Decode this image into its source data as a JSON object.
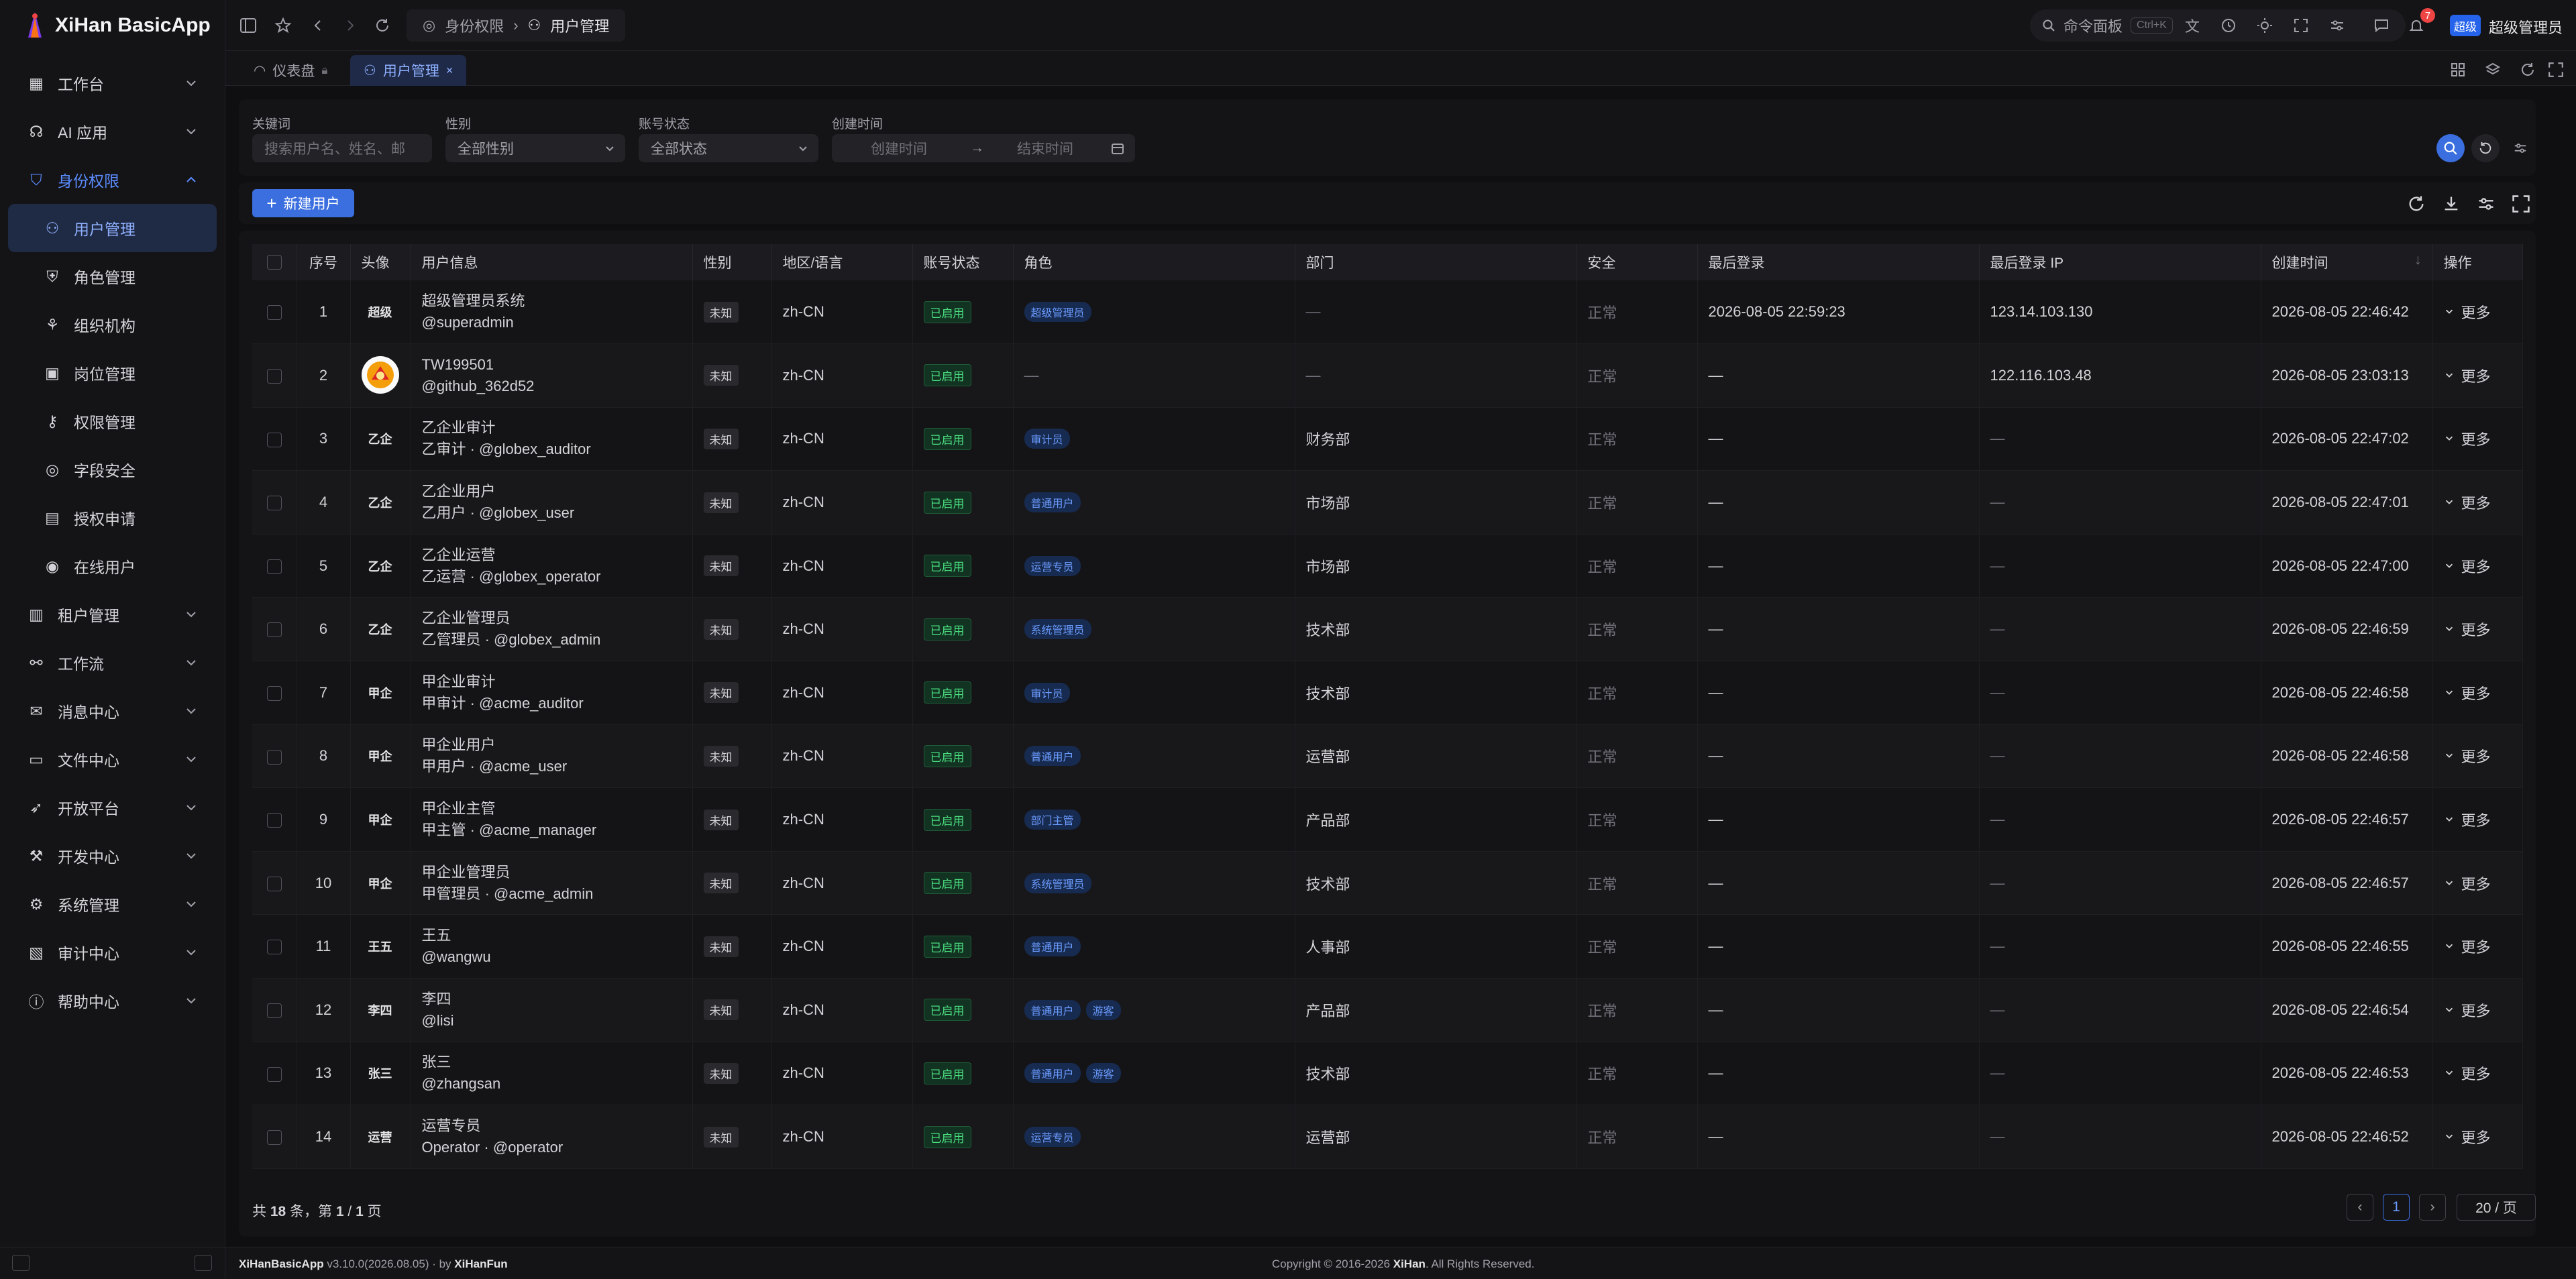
{
  "app": {
    "name": "XiHan BasicApp"
  },
  "sidebar": {
    "items": [
      {
        "label": "工作台",
        "icon": "dashboard-icon",
        "chevron": "down"
      },
      {
        "label": "AI 应用",
        "icon": "ai-icon",
        "chevron": "down"
      },
      {
        "label": "身份权限",
        "icon": "shield-icon",
        "chevron": "up",
        "open": true
      },
      {
        "label": "用户管理",
        "icon": "users-icon",
        "sub": true,
        "active": true
      },
      {
        "label": "角色管理",
        "icon": "role-icon",
        "sub": true
      },
      {
        "label": "组织机构",
        "icon": "org-icon",
        "sub": true
      },
      {
        "label": "岗位管理",
        "icon": "briefcase-icon",
        "sub": true
      },
      {
        "label": "权限管理",
        "icon": "key-icon",
        "sub": true
      },
      {
        "label": "字段安全",
        "icon": "eye-off-icon",
        "sub": true
      },
      {
        "label": "授权申请",
        "icon": "document-icon",
        "sub": true
      },
      {
        "label": "在线用户",
        "icon": "broadcast-icon",
        "sub": true
      },
      {
        "label": "租户管理",
        "icon": "building-icon",
        "chevron": "down"
      },
      {
        "label": "工作流",
        "icon": "workflow-icon",
        "chevron": "down"
      },
      {
        "label": "消息中心",
        "icon": "mail-icon",
        "chevron": "down"
      },
      {
        "label": "文件中心",
        "icon": "folder-icon",
        "chevron": "down"
      },
      {
        "label": "开放平台",
        "icon": "rocket-icon",
        "chevron": "down"
      },
      {
        "label": "开发中心",
        "icon": "hammer-icon",
        "chevron": "down"
      },
      {
        "label": "系统管理",
        "icon": "gear-icon",
        "chevron": "down"
      },
      {
        "label": "审计中心",
        "icon": "audit-icon",
        "chevron": "down"
      },
      {
        "label": "帮助中心",
        "icon": "info-icon",
        "chevron": "down"
      }
    ]
  },
  "topbar": {
    "breadcrumb": [
      "身份权限",
      "用户管理"
    ],
    "command_label": "命令面板",
    "command_shortcut": "Ctrl+K",
    "notification_count": "7",
    "avatar_text": "超级",
    "user_name": "超级管理员"
  },
  "tabs": [
    {
      "label": "仪表盘",
      "active": false
    },
    {
      "label": "用户管理",
      "active": true
    }
  ],
  "filters": {
    "keyword_label": "关键词",
    "keyword_placeholder": "搜索用户名、姓名、邮",
    "gender_label": "性别",
    "gender_value": "全部性别",
    "status_label": "账号状态",
    "status_value": "全部状态",
    "created_label": "创建时间",
    "created_start": "创建时间",
    "created_end": "结束时间"
  },
  "toolbar": {
    "new_user": "新建用户"
  },
  "table": {
    "columns": [
      "序号",
      "头像",
      "用户信息",
      "性别",
      "地区/语言",
      "账号状态",
      "角色",
      "部门",
      "安全",
      "最后登录",
      "最后登录 IP",
      "创建时间",
      "操作"
    ],
    "rows": [
      {
        "no": "1",
        "avatar": "超级",
        "name": "超级管理员系统",
        "sub": "@superadmin",
        "gender": "未知",
        "locale": "zh-CN",
        "status": "已启用",
        "roles": [
          "超级管理员"
        ],
        "dept": "—",
        "security": "正常",
        "last_login": "2026-08-05 22:59:23",
        "last_ip": "123.14.103.130",
        "created": "2026-08-05 22:46:42",
        "action": "更多"
      },
      {
        "no": "2",
        "avatar": "",
        "avatar_img": true,
        "name": "TW199501",
        "sub": "@github_362d52",
        "gender": "未知",
        "locale": "zh-CN",
        "status": "已启用",
        "roles": [],
        "roles_empty": "—",
        "dept": "—",
        "security": "正常",
        "last_login": "—",
        "last_ip": "122.116.103.48",
        "created": "2026-08-05 23:03:13",
        "action": "更多"
      },
      {
        "no": "3",
        "avatar": "乙企",
        "name": "乙企业审计",
        "sub": "乙审计 · @globex_auditor",
        "gender": "未知",
        "locale": "zh-CN",
        "status": "已启用",
        "roles": [
          "审计员"
        ],
        "dept": "财务部",
        "security": "正常",
        "last_login": "—",
        "last_ip": "—",
        "created": "2026-08-05 22:47:02",
        "action": "更多"
      },
      {
        "no": "4",
        "avatar": "乙企",
        "name": "乙企业用户",
        "sub": "乙用户 · @globex_user",
        "gender": "未知",
        "locale": "zh-CN",
        "status": "已启用",
        "roles": [
          "普通用户"
        ],
        "dept": "市场部",
        "security": "正常",
        "last_login": "—",
        "last_ip": "—",
        "created": "2026-08-05 22:47:01",
        "action": "更多"
      },
      {
        "no": "5",
        "avatar": "乙企",
        "name": "乙企业运营",
        "sub": "乙运营 · @globex_operator",
        "gender": "未知",
        "locale": "zh-CN",
        "status": "已启用",
        "roles": [
          "运营专员"
        ],
        "dept": "市场部",
        "security": "正常",
        "last_login": "—",
        "last_ip": "—",
        "created": "2026-08-05 22:47:00",
        "action": "更多"
      },
      {
        "no": "6",
        "avatar": "乙企",
        "name": "乙企业管理员",
        "sub": "乙管理员 · @globex_admin",
        "gender": "未知",
        "locale": "zh-CN",
        "status": "已启用",
        "roles": [
          "系统管理员"
        ],
        "dept": "技术部",
        "security": "正常",
        "last_login": "—",
        "last_ip": "—",
        "created": "2026-08-05 22:46:59",
        "action": "更多"
      },
      {
        "no": "7",
        "avatar": "甲企",
        "name": "甲企业审计",
        "sub": "甲审计 · @acme_auditor",
        "gender": "未知",
        "locale": "zh-CN",
        "status": "已启用",
        "roles": [
          "审计员"
        ],
        "dept": "技术部",
        "security": "正常",
        "last_login": "—",
        "last_ip": "—",
        "created": "2026-08-05 22:46:58",
        "action": "更多"
      },
      {
        "no": "8",
        "avatar": "甲企",
        "name": "甲企业用户",
        "sub": "甲用户 · @acme_user",
        "gender": "未知",
        "locale": "zh-CN",
        "status": "已启用",
        "roles": [
          "普通用户"
        ],
        "dept": "运营部",
        "security": "正常",
        "last_login": "—",
        "last_ip": "—",
        "created": "2026-08-05 22:46:58",
        "action": "更多"
      },
      {
        "no": "9",
        "avatar": "甲企",
        "name": "甲企业主管",
        "sub": "甲主管 · @acme_manager",
        "gender": "未知",
        "locale": "zh-CN",
        "status": "已启用",
        "roles": [
          "部门主管"
        ],
        "dept": "产品部",
        "security": "正常",
        "last_login": "—",
        "last_ip": "—",
        "created": "2026-08-05 22:46:57",
        "action": "更多"
      },
      {
        "no": "10",
        "avatar": "甲企",
        "name": "甲企业管理员",
        "sub": "甲管理员 · @acme_admin",
        "gender": "未知",
        "locale": "zh-CN",
        "status": "已启用",
        "roles": [
          "系统管理员"
        ],
        "dept": "技术部",
        "security": "正常",
        "last_login": "—",
        "last_ip": "—",
        "created": "2026-08-05 22:46:57",
        "action": "更多"
      },
      {
        "no": "11",
        "avatar": "王五",
        "name": "王五",
        "sub": "@wangwu",
        "gender": "未知",
        "locale": "zh-CN",
        "status": "已启用",
        "roles": [
          "普通用户"
        ],
        "dept": "人事部",
        "security": "正常",
        "last_login": "—",
        "last_ip": "—",
        "created": "2026-08-05 22:46:55",
        "action": "更多"
      },
      {
        "no": "12",
        "avatar": "李四",
        "name": "李四",
        "sub": "@lisi",
        "gender": "未知",
        "locale": "zh-CN",
        "status": "已启用",
        "roles": [
          "普通用户",
          "游客"
        ],
        "dept": "产品部",
        "security": "正常",
        "last_login": "—",
        "last_ip": "—",
        "created": "2026-08-05 22:46:54",
        "action": "更多"
      },
      {
        "no": "13",
        "avatar": "张三",
        "name": "张三",
        "sub": "@zhangsan",
        "gender": "未知",
        "locale": "zh-CN",
        "status": "已启用",
        "roles": [
          "普通用户",
          "游客"
        ],
        "dept": "技术部",
        "security": "正常",
        "last_login": "—",
        "last_ip": "—",
        "created": "2026-08-05 22:46:53",
        "action": "更多"
      },
      {
        "no": "14",
        "avatar": "运营",
        "name": "运营专员",
        "sub": "Operator · @operator",
        "gender": "未知",
        "locale": "zh-CN",
        "status": "已启用",
        "roles": [
          "运营专员"
        ],
        "dept": "运营部",
        "security": "正常",
        "last_login": "—",
        "last_ip": "—",
        "created": "2026-08-05 22:46:52",
        "action": "更多"
      }
    ]
  },
  "pagination": {
    "total_prefix": "共 ",
    "total_count": "18",
    "total_mid": " 条，第 ",
    "page_current": "1",
    "page_sep": " / ",
    "page_total": "1",
    "total_suffix": " 页",
    "current_page": "1",
    "page_size": "20 / 页"
  },
  "footer": {
    "version_app": "XiHanBasicApp",
    "version_text": " v3.10.0(2026.08.05) · by ",
    "version_author": "XiHanFun",
    "copyright_prefix": "Copyright © 2016-2026 ",
    "copyright_brand": "XiHan",
    "copyright_suffix": ". All Rights Reserved."
  },
  "colors": {
    "accent": "#3b6fe0",
    "bg": "#0f0f11",
    "panel": "#141417",
    "success": "#4ade80"
  }
}
